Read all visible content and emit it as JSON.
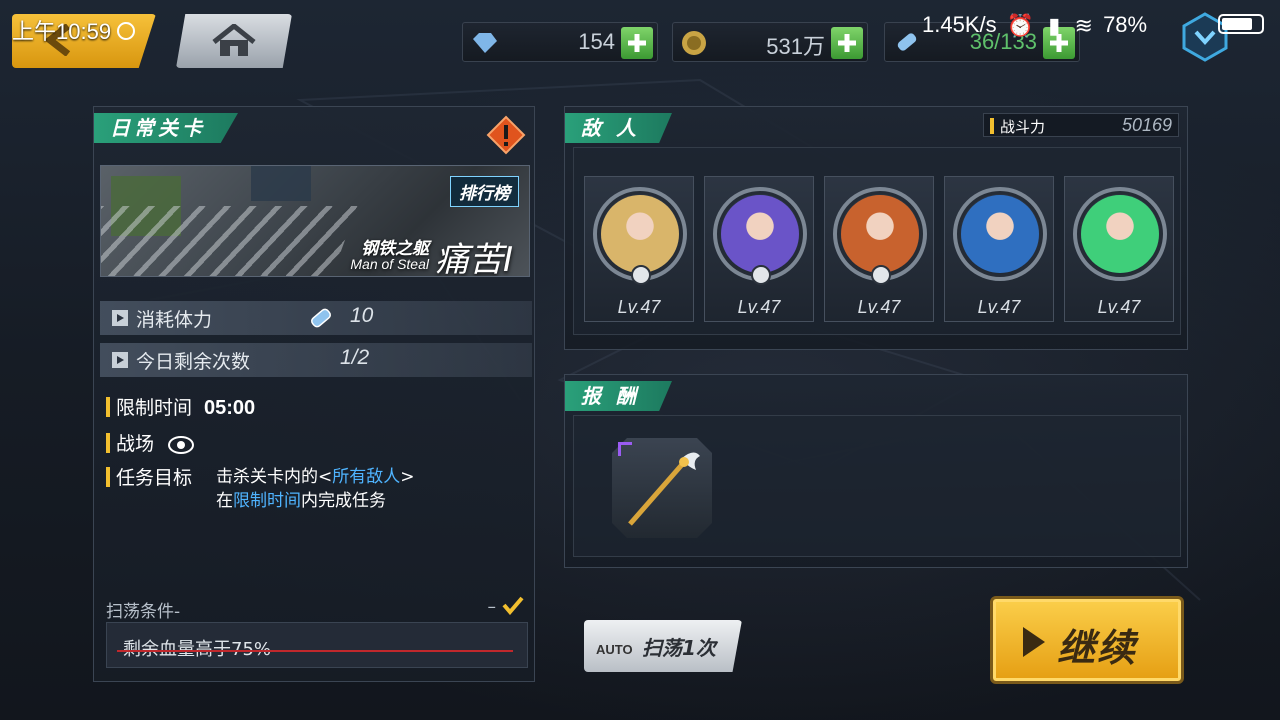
{
  "status_bar": {
    "time": "上午10:59",
    "network_speed": "1.45K/s",
    "battery": "78%"
  },
  "resources": [
    {
      "icon": "diamond-icon",
      "value": "154"
    },
    {
      "icon": "gold-coin-icon",
      "value": "531万"
    },
    {
      "icon": "stamina-bottle-icon",
      "value": "36/133"
    }
  ],
  "left_panel": {
    "tag": "日常关卡",
    "rank_label": "排行榜",
    "stage_name_cn": "钢铁之躯",
    "stage_name_en": "Man of Steal",
    "stage_title": "痛苦Ⅰ",
    "stamina_cost_label": "消耗体力",
    "stamina_cost_value": "10",
    "remaining_label": "今日剩余次数",
    "remaining_value": "1/2",
    "time_limit_label": "限制时间",
    "time_limit_value": "05:00",
    "battlefield_label": "战场",
    "objective_label": "任务目标",
    "objective_line1_pre": "击杀关卡内的<",
    "objective_line1_hl": "所有敌人",
    "objective_line1_post": ">",
    "objective_line2_pre": "在",
    "objective_line2_hl": "限制时间",
    "objective_line2_post": "内完成任务",
    "sweep_title": "扫荡条件-",
    "sweep_dash": "–",
    "sweep_condition": "剩余血量高于75%"
  },
  "enemy_panel": {
    "tag": "敌 人",
    "power_label": "战斗力",
    "power_value": "50169",
    "enemies": [
      {
        "level": "Lv.47",
        "color": "#d9b56a"
      },
      {
        "level": "Lv.47",
        "color": "#6a54c8"
      },
      {
        "level": "Lv.47",
        "color": "#c8622e"
      },
      {
        "level": "Lv.47",
        "color": "#2f6fc0"
      },
      {
        "level": "Lv.47",
        "color": "#3fcf7a"
      }
    ]
  },
  "reward_panel": {
    "tag": "报 酬",
    "item_icon": "golden-staff-icon",
    "item_rarity_color": "#9a5cf2"
  },
  "buttons": {
    "auto_icon_text": "AUTO",
    "sweep_label": "扫荡1次",
    "continue_label": "继续"
  }
}
